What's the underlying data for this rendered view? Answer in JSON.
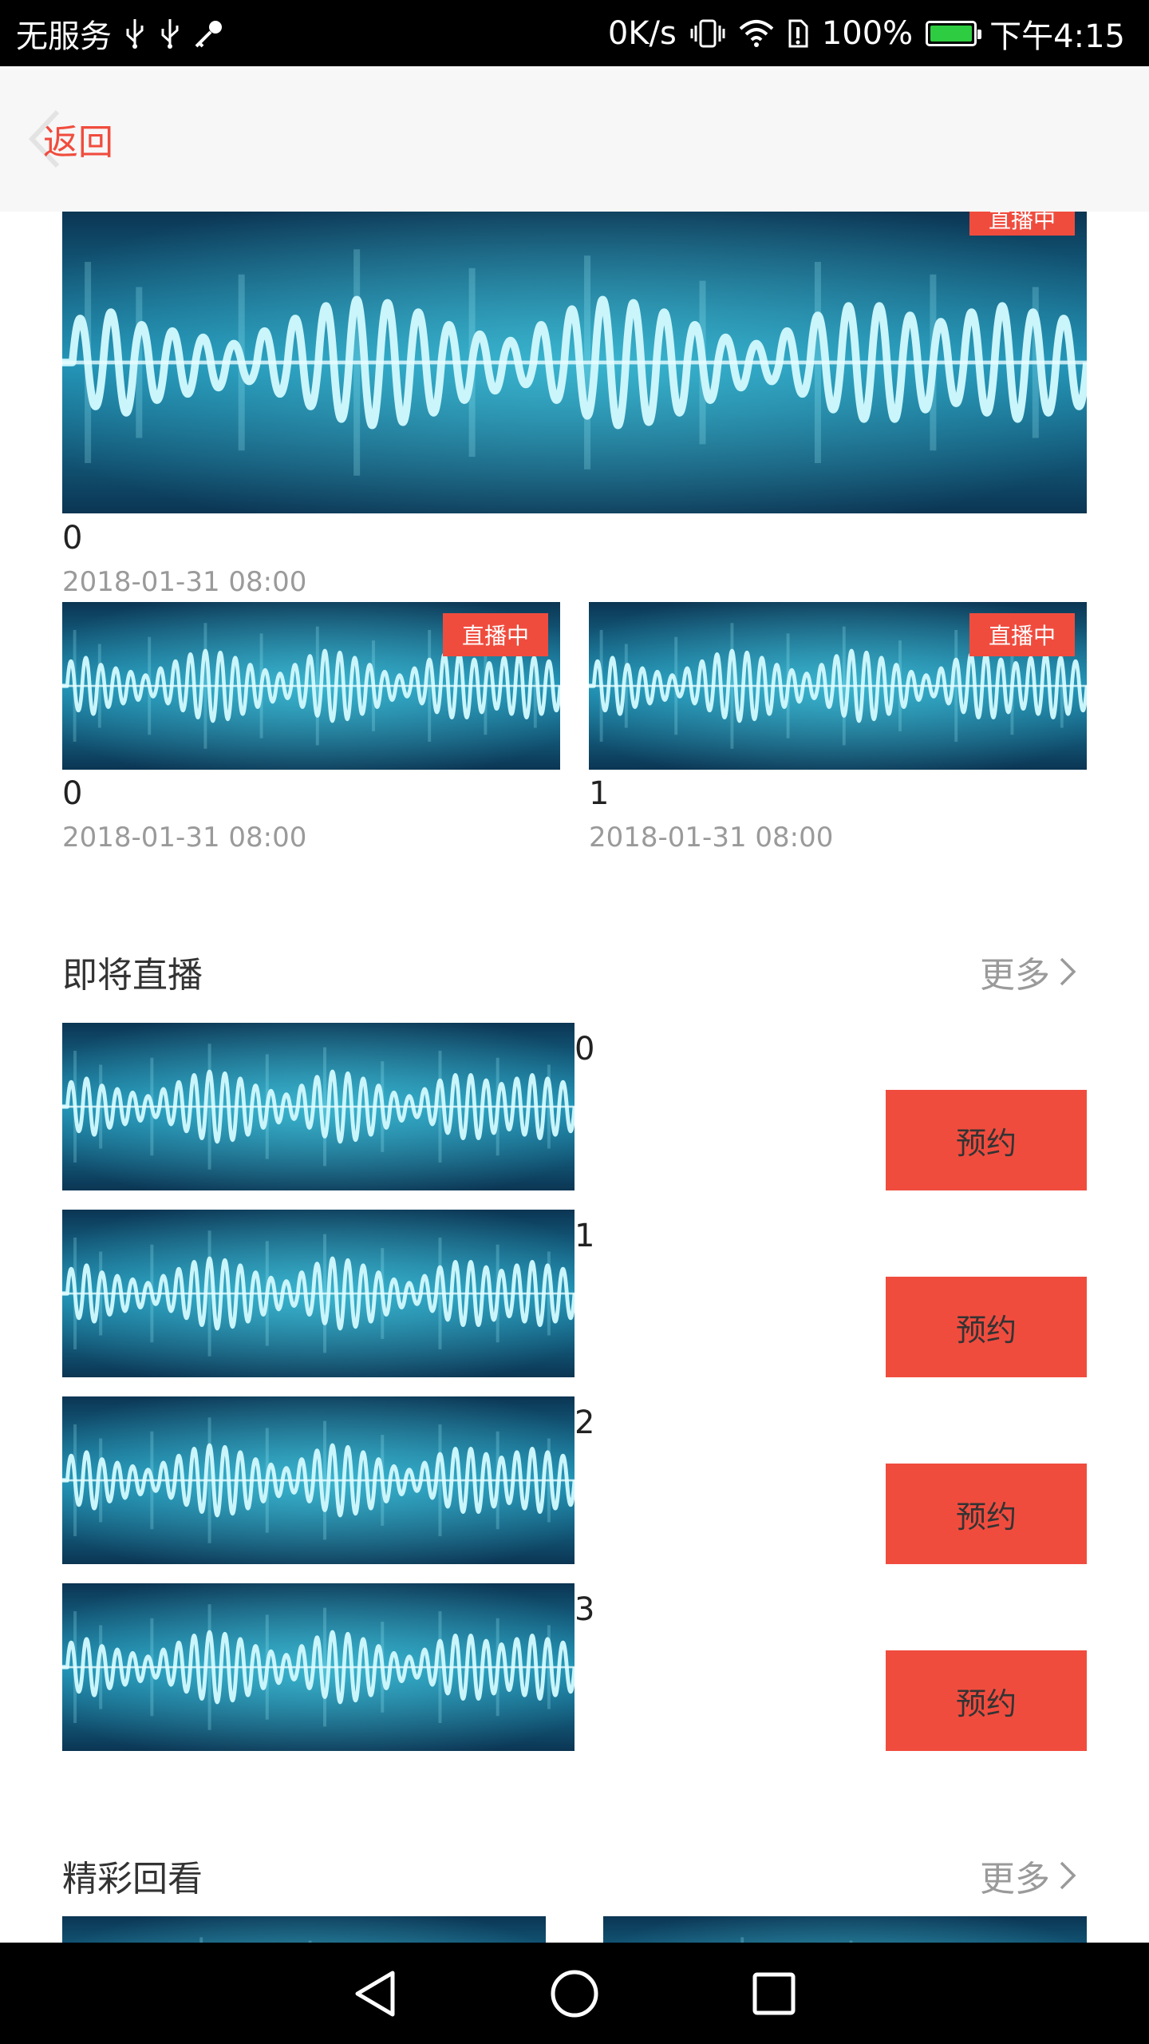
{
  "status_bar": {
    "carrier": "无服务",
    "net_speed": "0K/s",
    "battery": "100%",
    "time": "下午4:15"
  },
  "header": {
    "back_label": "返回"
  },
  "live_badge_label": "直播中",
  "featured": {
    "title": "0",
    "date": "2018-01-31 08:00"
  },
  "live_grid": [
    {
      "title": "0",
      "date": "2018-01-31 08:00"
    },
    {
      "title": "1",
      "date": "2018-01-31 08:00"
    }
  ],
  "upcoming": {
    "title": "即将直播",
    "more_label": "更多",
    "button_label": "预约",
    "items": [
      {
        "title": "0"
      },
      {
        "title": "1"
      },
      {
        "title": "2"
      },
      {
        "title": "3"
      }
    ]
  },
  "replay": {
    "title": "精彩回看",
    "more_label": "更多"
  },
  "colors": {
    "accent": "#f04c3e",
    "header_bg": "#f7f7f7",
    "muted_text": "#9a9a9a",
    "wave_dark": "#0b2f4a",
    "wave_light": "#5fd6e8"
  },
  "icons": {
    "status": [
      "usb-icon",
      "usb-icon",
      "key-icon",
      "vibrate-icon",
      "wifi-icon",
      "sim-alert-icon",
      "battery-icon"
    ],
    "nav": [
      "back-triangle-icon",
      "home-circle-icon",
      "recents-square-icon"
    ]
  }
}
